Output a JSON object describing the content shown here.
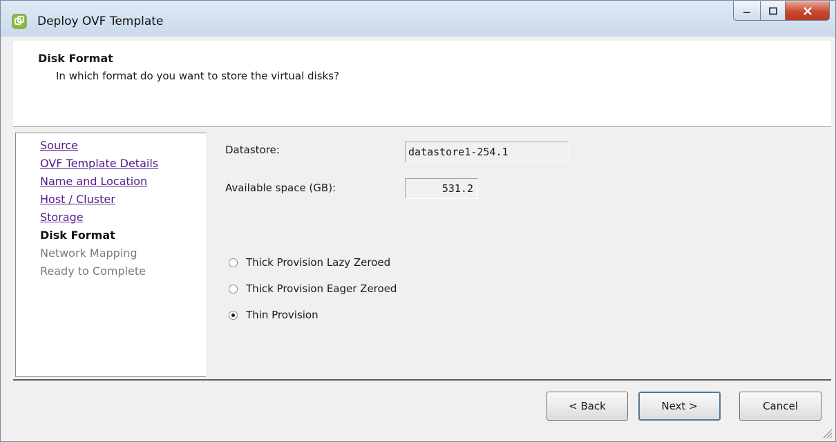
{
  "window": {
    "title": "Deploy OVF Template"
  },
  "header": {
    "title": "Disk Format",
    "subtitle": "In which format do you want to store the virtual disks?"
  },
  "nav": {
    "items": [
      {
        "label": "Source",
        "state": "visited"
      },
      {
        "label": "OVF Template Details",
        "state": "visited"
      },
      {
        "label": "Name and Location",
        "state": "visited"
      },
      {
        "label": "Host / Cluster",
        "state": "visited"
      },
      {
        "label": "Storage",
        "state": "visited"
      },
      {
        "label": "Disk Format",
        "state": "current"
      },
      {
        "label": "Network Mapping",
        "state": "pending"
      },
      {
        "label": "Ready to Complete",
        "state": "pending"
      }
    ]
  },
  "form": {
    "datastore_label": "Datastore:",
    "datastore_value": "datastore1-254.1",
    "space_label": "Available space (GB):",
    "space_value": "531.2",
    "options": [
      {
        "label": "Thick Provision Lazy Zeroed",
        "checked": false
      },
      {
        "label": "Thick Provision Eager Zeroed",
        "checked": false
      },
      {
        "label": "Thin Provision",
        "checked": true
      }
    ]
  },
  "buttons": {
    "back": "< Back",
    "next": "Next >",
    "cancel": "Cancel"
  },
  "icons": {
    "app": "vsphere-icon",
    "close": "close-icon",
    "minimize": "minimize-icon",
    "maximize": "maximize-icon"
  },
  "colors": {
    "visited_link": "#551a8b",
    "pending": "#7a7a7a",
    "close_btn": "#c9492f"
  }
}
